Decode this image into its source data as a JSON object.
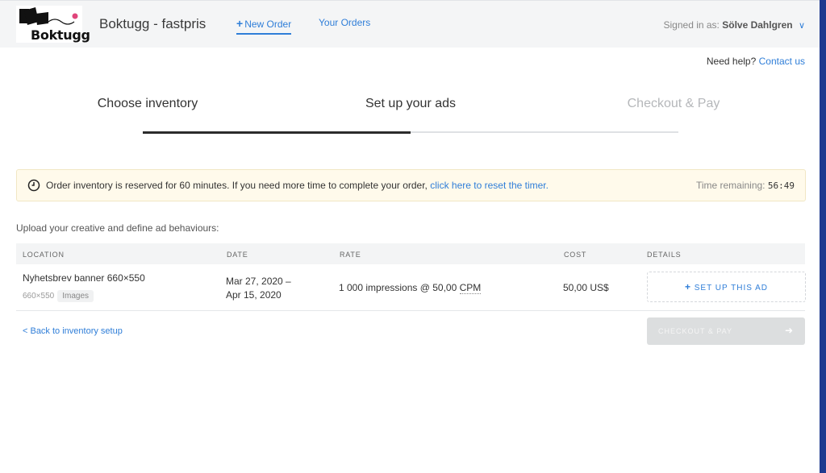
{
  "header": {
    "logo_text": "Boktugg",
    "app_title": "Boktugg - fastpris",
    "nav": {
      "new_order": "New Order",
      "your_orders": "Your Orders"
    },
    "signed_in_label": "Signed in as:",
    "user_name": "Sölve Dahlgren"
  },
  "help": {
    "text": "Need help?",
    "link": "Contact us"
  },
  "steps": [
    {
      "label": "Choose inventory",
      "state": "done"
    },
    {
      "label": "Set up your ads",
      "state": "current"
    },
    {
      "label": "Checkout & Pay",
      "state": "upcoming"
    }
  ],
  "progress_fraction": 0.5,
  "timer": {
    "message": "Order inventory is reserved for 60 minutes. If you need more time to complete your order,",
    "link": "click here to reset the timer.",
    "remaining_label": "Time remaining:",
    "remaining_value": "56:49"
  },
  "upload_text": "Upload your creative and define ad behaviours:",
  "table": {
    "headers": [
      "LOCATION",
      "DATE",
      "RATE",
      "COST",
      "DETAILS"
    ],
    "rows": [
      {
        "location": "Nyhetsbrev banner 660×550",
        "size": "660×550",
        "type_badge": "Images",
        "date_start": "Mar 27, 2020 –",
        "date_end": "Apr 15, 2020",
        "rate_text": "1 000 impressions @ 50,00",
        "rate_unit": "CPM",
        "cost": "50,00 US$",
        "action": "SET UP THIS AD"
      }
    ]
  },
  "footer": {
    "back_link": "< Back to inventory setup",
    "checkout": "CHECKOUT & PAY"
  },
  "colors": {
    "accent": "#2f7ed8",
    "timer_bg": "#fffaeb",
    "disabled_btn": "#dcdedf"
  }
}
